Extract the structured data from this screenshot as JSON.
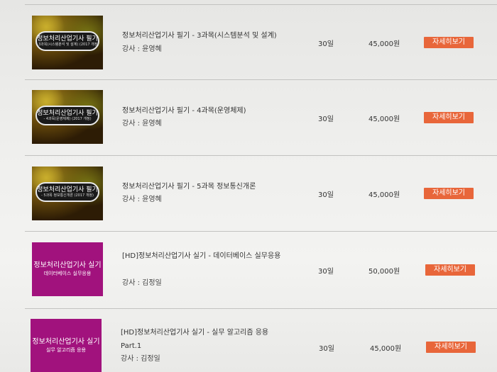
{
  "courses": [
    {
      "thumb": {
        "style": "dark",
        "line1": "정보처리산업기사 필기",
        "line2": "- 3과목(시스템분석 및 설계) (2017 개정)"
      },
      "title": "정보처리산업기사 필기 - 3과목(시스템분석 및 설계)",
      "instructor": "강사 : 윤영혜",
      "days": "30일",
      "price": "45,000원",
      "button": "자세히보기"
    },
    {
      "thumb": {
        "style": "dark",
        "line1": "정보처리산업기사 필기",
        "line2": "- 4과목(운영체제) (2017 개정)"
      },
      "title": "정보처리산업기사 필기 - 4과목(운영체제)",
      "instructor": "강사 : 윤영혜",
      "days": "30일",
      "price": "45,000원",
      "button": "자세히보기"
    },
    {
      "thumb": {
        "style": "dark",
        "line1": "정보처리산업기사 필기",
        "line2": "- 5과목 정보통신개론 (2017 개정)"
      },
      "title": "정보처리산업기사 필기 - 5과목 정보통신개론",
      "instructor": "강사 : 윤영혜",
      "days": "30일",
      "price": "45,000원",
      "button": "자세히보기"
    },
    {
      "thumb": {
        "style": "magenta",
        "line1": "정보처리산업기사 실기",
        "line2": "데이터베이스 실무응용"
      },
      "title": "[HD]정보처리산업기사 실기 - 데이터베이스 실무응용",
      "instructor": "강사 : 김정일",
      "days": "30일",
      "price": "50,000원",
      "button": "자세히보기"
    },
    {
      "thumb": {
        "style": "magenta",
        "line1": "정보처리산업기사 실기",
        "line2": "실무 알고리즘 응용"
      },
      "title": "[HD]정보처리산업기사 실기 - 실무 알고리즘 응용 Part.1",
      "instructor": "강사 : 김정일",
      "days": "30일",
      "price": "45,000원",
      "button": "자세히보기"
    }
  ],
  "colors": {
    "button": "#e8663a",
    "magenta_thumb": "#a1127d"
  }
}
